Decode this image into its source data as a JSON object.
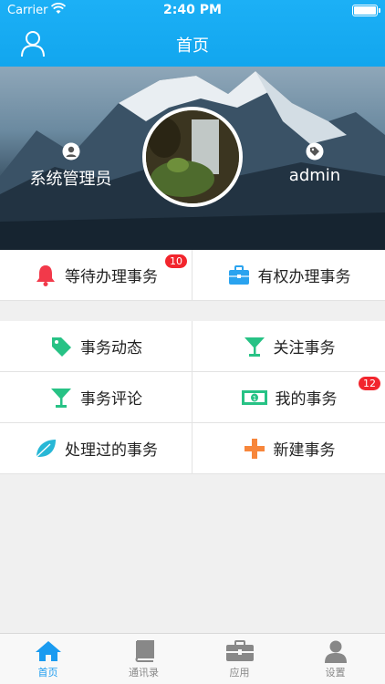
{
  "status": {
    "carrier": "Carrier",
    "time": "2:40 PM"
  },
  "nav": {
    "title": "首页"
  },
  "hero": {
    "left_label": "系统管理员",
    "right_label": "admin"
  },
  "top_actions": [
    {
      "label": "等待办理事务",
      "badge": "10",
      "icon": "bell-icon"
    },
    {
      "label": "有权办理事务",
      "icon": "briefcase-icon"
    }
  ],
  "menu": [
    {
      "label": "事务动态",
      "icon": "tag-icon"
    },
    {
      "label": "关注事务",
      "icon": "cocktail-icon"
    },
    {
      "label": "事务评论",
      "icon": "cocktail-icon"
    },
    {
      "label": "我的事务",
      "badge": "12",
      "icon": "money-icon"
    },
    {
      "label": "处理过的事务",
      "icon": "leaf-icon"
    },
    {
      "label": "新建事务",
      "icon": "plus-icon"
    }
  ],
  "tabs": [
    {
      "label": "首页",
      "icon": "home-icon",
      "active": true
    },
    {
      "label": "通讯录",
      "icon": "book-icon"
    },
    {
      "label": "应用",
      "icon": "briefcase-icon"
    },
    {
      "label": "设置",
      "icon": "user-icon"
    }
  ],
  "colors": {
    "accent": "#1a9bf0",
    "badge": "#f2252d",
    "green": "#27c285",
    "orange": "#f7863b"
  }
}
